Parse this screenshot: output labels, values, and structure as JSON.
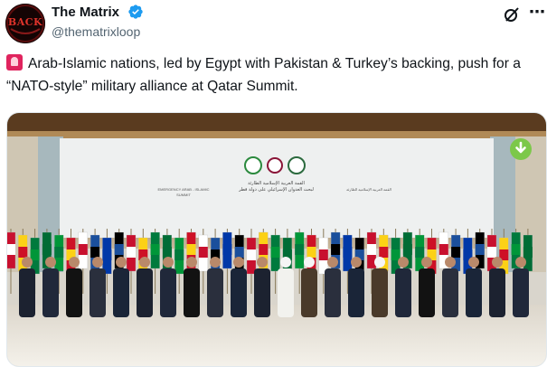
{
  "account": {
    "display_name": "The Matrix",
    "handle": "@thematrixloop",
    "avatar_text": "BACK",
    "verified": true
  },
  "post": {
    "text": "Arab-Islamic nations, led by Egypt with Pakistan & Turkey’s backing, push for a “NATO-style” military alliance at Qatar Summit."
  },
  "media": {
    "banner_center": "القمة العربية الإسلامية الطارئة",
    "banner_center_sub": "لبحث العدوان الإسرائيلي على دولة قطر",
    "banner_left": "EMERGENCY ARAB - ISLAMIC SUMMIT",
    "banner_right": "القمة العربية الإسلامية الطارئة"
  },
  "icons": {
    "verified": "verified-badge-icon",
    "grok": "grok-icon",
    "more": "more-icon",
    "alert": "siren-emoji-icon",
    "download": "download-icon"
  },
  "colors": {
    "verified": "#1d9bf0",
    "alert": "#e0245e",
    "download": "#7cc84a"
  }
}
